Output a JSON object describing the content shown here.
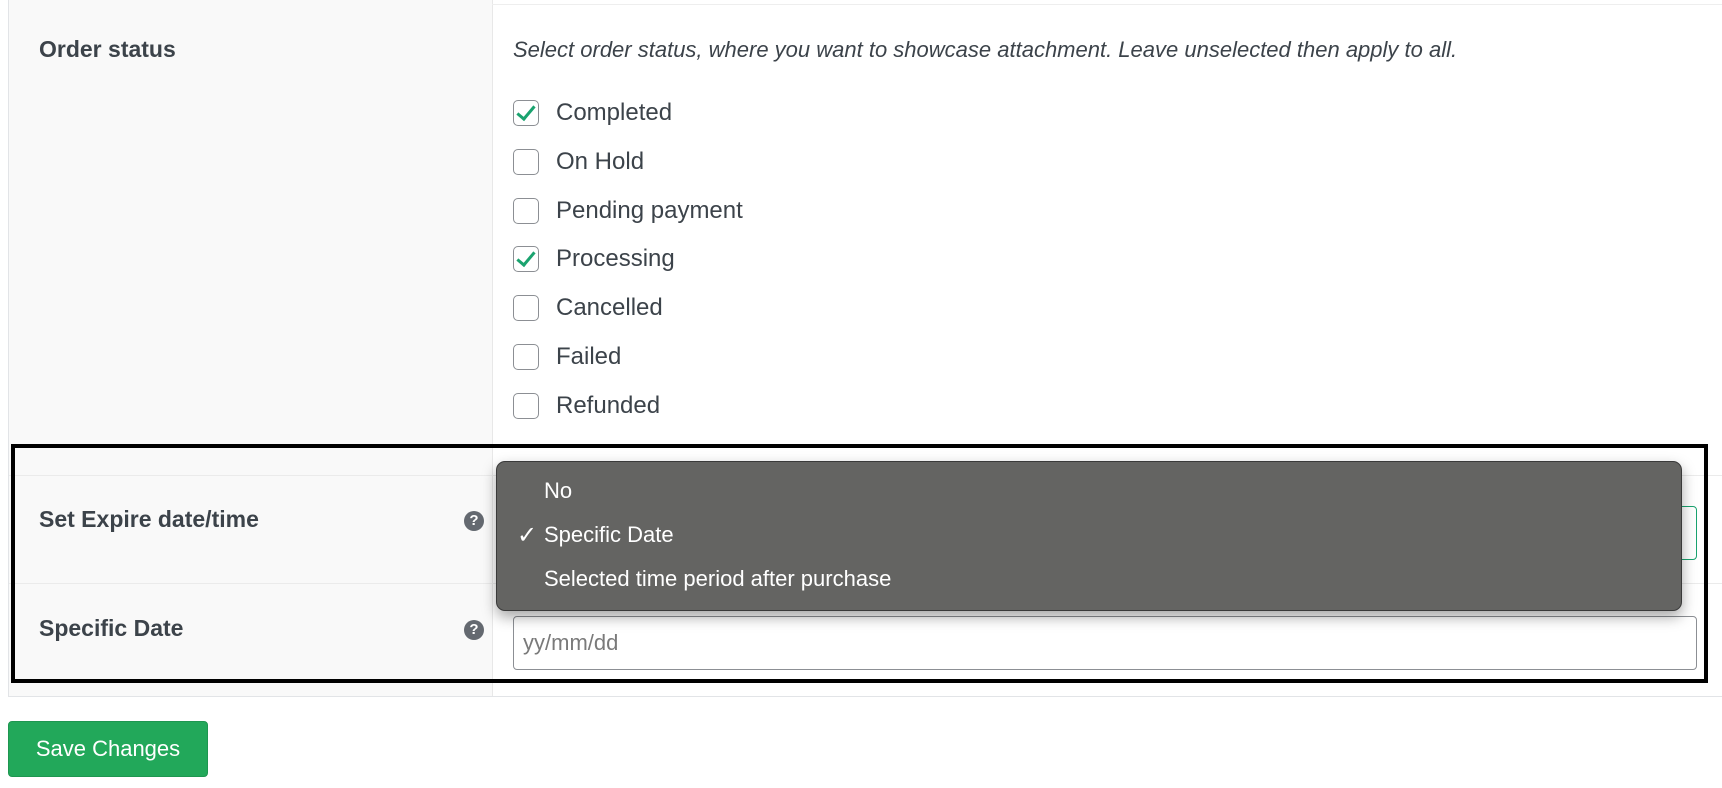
{
  "order_status": {
    "label": "Order status",
    "description": "Select order status, where you want to showcase attachment. Leave unselected then apply to all.",
    "options": [
      {
        "label": "Completed",
        "checked": true
      },
      {
        "label": "On Hold",
        "checked": false
      },
      {
        "label": "Pending payment",
        "checked": false
      },
      {
        "label": "Processing",
        "checked": true
      },
      {
        "label": "Cancelled",
        "checked": false
      },
      {
        "label": "Failed",
        "checked": false
      },
      {
        "label": "Refunded",
        "checked": false
      }
    ]
  },
  "expire": {
    "label": "Set Expire date/time",
    "help_icon": "question-circle-icon",
    "selected": "Specific Date",
    "options": [
      {
        "label": "No",
        "selected": false
      },
      {
        "label": "Specific Date",
        "selected": true
      },
      {
        "label": "Selected time period after purchase",
        "selected": false
      }
    ],
    "check_glyph": "✓"
  },
  "specific_date": {
    "label": "Specific Date",
    "help_icon": "question-circle-icon",
    "placeholder": "yy/mm/dd",
    "value": ""
  },
  "help_glyph": "?",
  "save_button": {
    "label": "Save Changes"
  },
  "colors": {
    "accent_green": "#22a85a",
    "checkmark_green": "#1aa36f",
    "dropdown_bg": "#646462",
    "label_col_bg": "#f9f9f9",
    "text": "#3c434a"
  }
}
